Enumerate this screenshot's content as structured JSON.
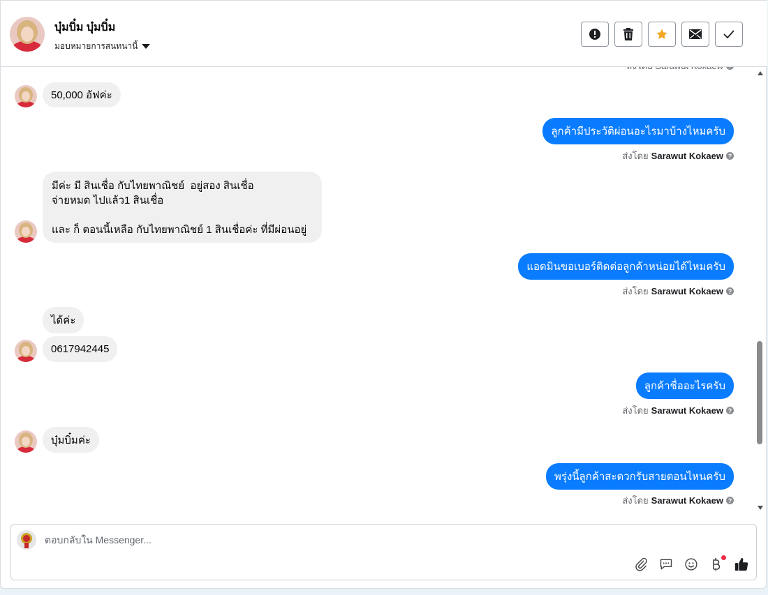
{
  "header": {
    "name": "บุ๋มบิ๋ม บุ๋มบิ๋ม",
    "subtitle": "มอบหมายการสนทนานี้",
    "actions": [
      {
        "icon": "exclamation-circle-icon"
      },
      {
        "icon": "trash-icon"
      },
      {
        "icon": "star-icon",
        "color": "#f5a623"
      },
      {
        "icon": "envelope-icon"
      },
      {
        "icon": "check-icon"
      }
    ]
  },
  "messages": {
    "top_partial_meta": "ส่งโดย Sarawut Kokaew",
    "in1": "50,000 อัฟค่ะ",
    "out1": "ลูกค้ามีประวัติผ่อนอะไรมาบ้างไหมครับ",
    "in2": "มีค่ะ มี สินเชื่อ กับไทยพาณิชย์  อยู่สอง สินเชื่อ\nจ่ายหมด ไปแล้ว1 สินเชื่อ\n\nและ ก็ ตอนนี้เหลือ กับไทยพาณิชย์ 1 สินเชื่อค่ะ ที่มีผ่อนอยู่",
    "out2": "แอดมินขอเบอร์ติดต่อลูกค้าหน่อยได้ไหมครับ",
    "in3": "ได้ค่ะ",
    "in4": "0617942445",
    "out3": "ลูกค้าชื่ออะไรครับ",
    "in5": "บุ๋มบิ๋มค่ะ",
    "out4": "พรุ่งนี้ลูกค้าสะดวกรับสายตอนไหนครับ",
    "sent_by_prefix": "ส่งโดย",
    "sent_by_name": "Sarawut Kokaew"
  },
  "composer": {
    "placeholder": "ตอบกลับใน Messenger..."
  },
  "colors": {
    "outgoing_bubble": "#0a7cff",
    "incoming_bubble": "#f0f0f0",
    "star": "#f5a623",
    "notification_dot": "#f02849"
  }
}
